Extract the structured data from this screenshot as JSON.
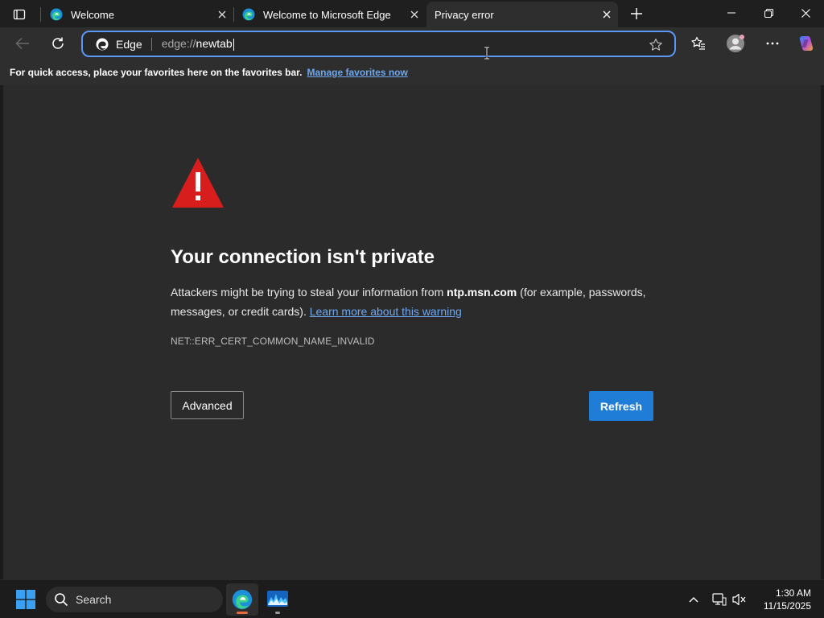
{
  "tabs": [
    {
      "title": "Welcome",
      "active": false
    },
    {
      "title": "Welcome to Microsoft Edge",
      "active": false
    },
    {
      "title": "Privacy error",
      "active": true
    }
  ],
  "address": {
    "site_label": "Edge",
    "url_prefix": "edge://",
    "url_value": "newtab"
  },
  "favorites_bar": {
    "message": "For quick access, place your favorites here on the favorites bar.",
    "link": "Manage favorites now"
  },
  "error_page": {
    "heading": "Your connection isn't private",
    "body_before": "Attackers might be trying to steal your information from ",
    "host": "ntp.msn.com",
    "body_after": " (for example, passwords, messages, or credit cards).",
    "learn_more": "Learn more about this warning",
    "error_code": "NET::ERR_CERT_COMMON_NAME_INVALID",
    "advanced_label": "Advanced",
    "refresh_label": "Refresh"
  },
  "taskbar": {
    "search_placeholder": "Search",
    "time": "1:30 AM",
    "date": "11/15/2025"
  },
  "colors": {
    "accent": "#1f7dd8",
    "link": "#6ea8f0",
    "warning": "#d81d1d",
    "address_focus": "#5b97f5"
  }
}
